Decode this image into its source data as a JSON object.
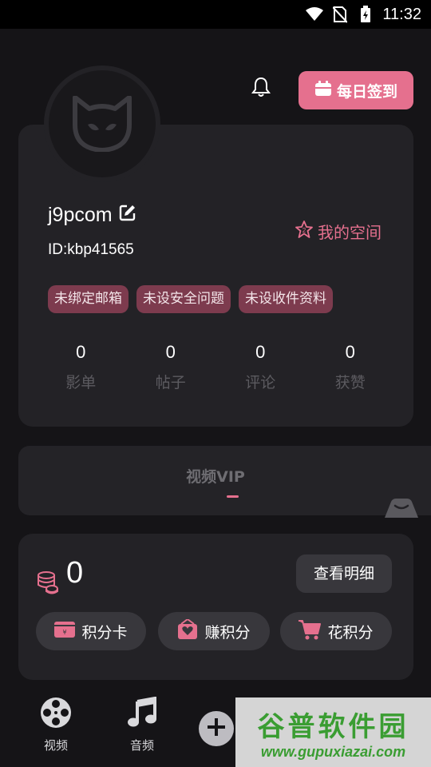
{
  "status_bar": {
    "time": "11:32"
  },
  "header": {
    "checkin_label": "每日签到"
  },
  "profile": {
    "username": "j9pcom",
    "user_id": "ID:kbp41565",
    "my_space_label": "我的空间",
    "tags": [
      "未绑定邮箱",
      "未设安全问题",
      "未设收件资料"
    ],
    "stats": [
      {
        "value": "0",
        "label": "影单"
      },
      {
        "value": "0",
        "label": "帖子"
      },
      {
        "value": "0",
        "label": "评论"
      },
      {
        "value": "0",
        "label": "获赞"
      }
    ]
  },
  "vip": {
    "tab_label": "视频VIP"
  },
  "points": {
    "value": "0",
    "detail_label": "查看明细",
    "buttons": [
      {
        "label": "积分卡",
        "icon": "card-icon"
      },
      {
        "label": "赚积分",
        "icon": "gift-box-icon"
      },
      {
        "label": "花积分",
        "icon": "cart-icon"
      }
    ]
  },
  "bottom_nav": {
    "items": [
      {
        "label": "视频",
        "icon": "film-reel-icon"
      },
      {
        "label": "音频",
        "icon": "music-note-icon"
      }
    ]
  },
  "watermark": {
    "title": "谷普软件园",
    "url": "www.gupuxiazai.com"
  },
  "colors": {
    "accent": "#e5708e",
    "background": "#151417",
    "card": "#232226",
    "tag_bg": "#7d3b4e"
  }
}
